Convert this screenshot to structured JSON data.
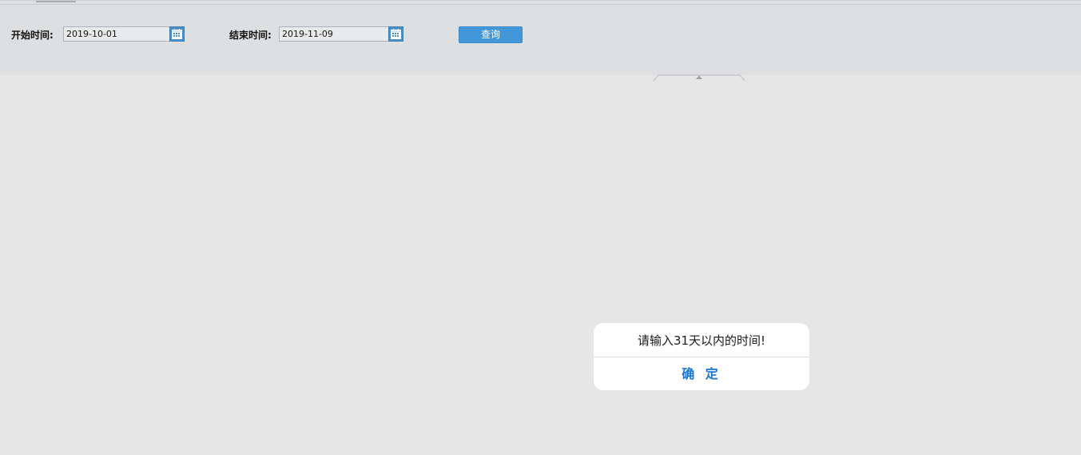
{
  "filter": {
    "start_label": "开始时间:",
    "start_value": "2019-10-01",
    "end_label": "结束时间:",
    "end_value": "2019-11-09",
    "query_label": "查询",
    "calendar_icon": "calendar-icon"
  },
  "dialog": {
    "message": "请输入31天以内的时间!",
    "confirm_label": "确 定"
  },
  "colors": {
    "accent": "#4197d8",
    "confirm_text": "#1976d2",
    "panel_bg": "#dedfe1",
    "page_bg": "#e6e6e6"
  }
}
